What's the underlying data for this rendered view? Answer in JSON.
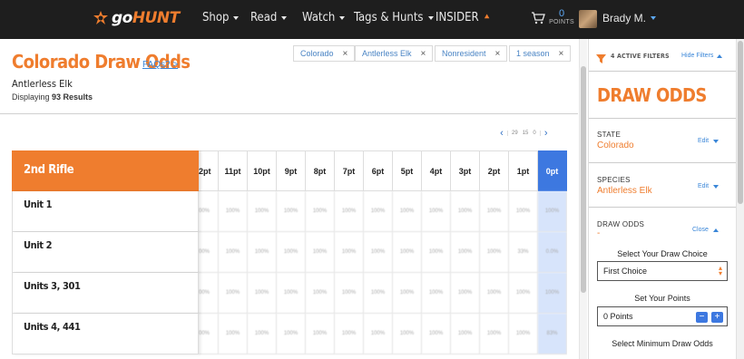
{
  "nav": {
    "logo_go": "go",
    "logo_hunt": "HUNT",
    "items": [
      "Shop",
      "Read",
      "Watch",
      "Tags & Hunts",
      "INSIDER"
    ],
    "points_value": "0",
    "points_label": "POINTS",
    "user_name": "Brady M."
  },
  "header": {
    "title": "Colorado Draw Odds",
    "faqs": "FAQs? >",
    "subtitle": "Antlerless Elk",
    "results_prefix": "Displaying ",
    "results_count": "93 Results"
  },
  "chips": [
    {
      "label": "Colorado",
      "remove": "×"
    },
    {
      "label": "Antlerless Elk",
      "remove": "×"
    },
    {
      "label": "Nonresident",
      "remove": "×"
    },
    {
      "label": "1 season",
      "remove": "×"
    }
  ],
  "pager": {
    "prev": "‹",
    "next": "›",
    "a": "29",
    "b": "15",
    "c": "0"
  },
  "table": {
    "season": "2nd Rifle",
    "units": [
      "Unit 1",
      "Unit 2",
      "Units 3, 301",
      "Units 4, 441"
    ],
    "point_cols": [
      "2pt",
      "11pt",
      "10pt",
      "9pt",
      "8pt",
      "7pt",
      "6pt",
      "5pt",
      "4pt",
      "3pt",
      "2pt",
      "1pt",
      "0pt"
    ],
    "rows": [
      [
        "00%",
        "100%",
        "100%",
        "100%",
        "100%",
        "100%",
        "100%",
        "100%",
        "100%",
        "100%",
        "100%",
        "100%",
        "100%"
      ],
      [
        "00%",
        "100%",
        "100%",
        "100%",
        "100%",
        "100%",
        "100%",
        "100%",
        "100%",
        "100%",
        "100%",
        "33%",
        "0.0%"
      ],
      [
        "00%",
        "100%",
        "100%",
        "100%",
        "100%",
        "100%",
        "100%",
        "100%",
        "100%",
        "100%",
        "100%",
        "100%",
        "100%"
      ],
      [
        "00%",
        "100%",
        "100%",
        "100%",
        "100%",
        "100%",
        "100%",
        "100%",
        "100%",
        "100%",
        "100%",
        "100%",
        "83%"
      ]
    ]
  },
  "panel": {
    "active_filters": "4 ACTIVE FILTERS",
    "hide_filters": "Hide Filters",
    "title": "DRAW ODDS",
    "state_label": "STATE",
    "state_value": "Colorado",
    "species_label": "SPECIES",
    "species_value": "Antlerless Elk",
    "edit": "Edit",
    "draw_odds_label": "DRAW ODDS",
    "draw_odds_value": "-",
    "close": "Close",
    "draw_choice_caption": "Select Your Draw Choice",
    "draw_choice_value": "First Choice",
    "points_caption": "Set Your Points",
    "points_value": "0 Points",
    "minus": "−",
    "plus": "+",
    "min_odds_caption": "Select Minimum Draw Odds"
  },
  "colors": {
    "accent": "#ef7d2e",
    "link": "#3a86d8",
    "active_col": "#3d78e0",
    "nav_bg": "#1e1e1e"
  }
}
